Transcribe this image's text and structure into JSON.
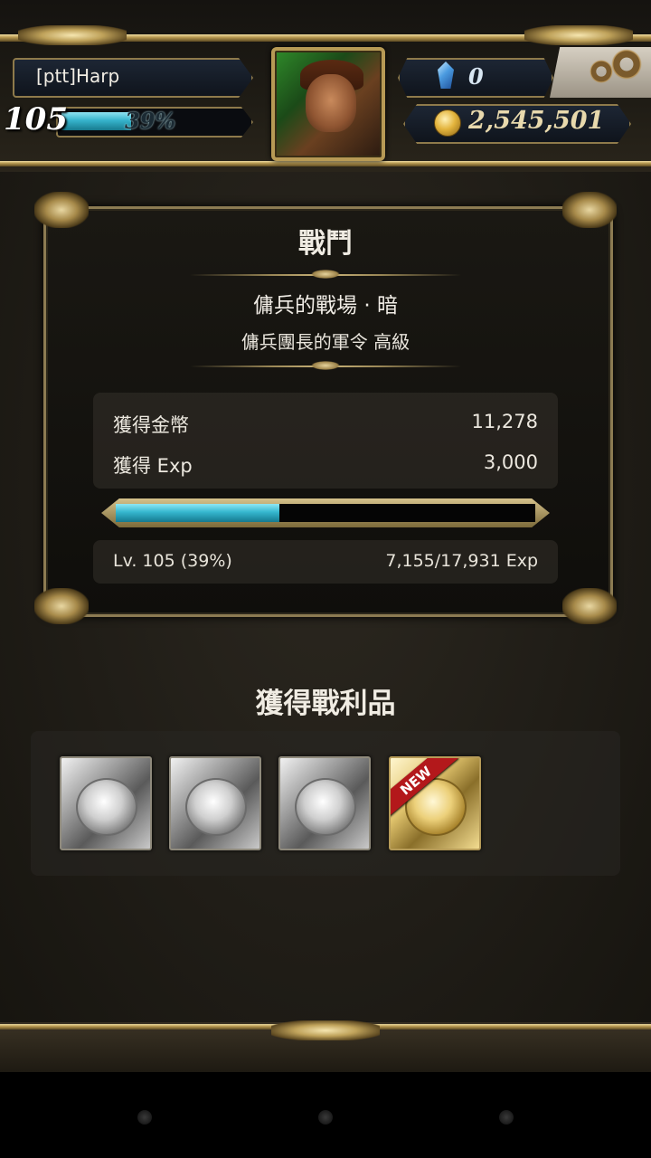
{
  "player": {
    "name": "[ptt]Harp",
    "level": "105",
    "exp_percent_text": "39%",
    "exp_fraction": 0.39
  },
  "currency": {
    "gems": "0",
    "gold": "2,545,501"
  },
  "battle": {
    "title": "戰鬥",
    "stage": "傭兵的戰場 · 暗",
    "quest": "傭兵團長的軍令 高級",
    "rewards": [
      {
        "label": "獲得金幣",
        "value": "11,278"
      },
      {
        "label": "獲得 Exp",
        "value": "3,000"
      }
    ],
    "level_text": "Lv. 105 (39%)",
    "exp_text": "7,155/17,931 Exp",
    "exp_fraction": 0.39
  },
  "loot": {
    "title": "獲得戰利品",
    "items": [
      {
        "kind": "silver-card"
      },
      {
        "kind": "silver-card"
      },
      {
        "kind": "silver-card"
      },
      {
        "kind": "gold-card",
        "badge": "NEW"
      }
    ]
  },
  "colors": {
    "exp_bar": "#35b7cf",
    "gold_trim": "#b99a52",
    "new_ribbon": "#b3181b"
  },
  "icons": [
    "gem-icon",
    "gold-coin-icon",
    "settings-gears-icon",
    "player-portrait"
  ]
}
